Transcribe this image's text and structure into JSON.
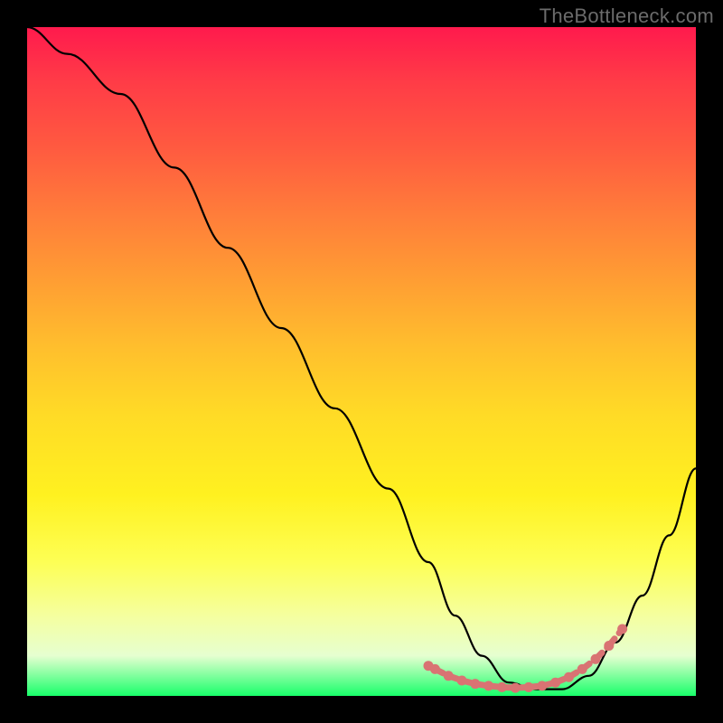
{
  "watermark": "TheBottleneck.com",
  "chart_data": {
    "type": "line",
    "title": "",
    "xlabel": "",
    "ylabel": "",
    "xlim": [
      0,
      100
    ],
    "ylim": [
      0,
      100
    ],
    "grid": false,
    "series": [
      {
        "name": "bottleneck-curve",
        "color": "#000000",
        "x": [
          0,
          6,
          14,
          22,
          30,
          38,
          46,
          54,
          60,
          64,
          68,
          72,
          76,
          80,
          84,
          88,
          92,
          96,
          100
        ],
        "values": [
          100,
          96,
          90,
          79,
          67,
          55,
          43,
          31,
          20,
          12,
          6,
          2,
          1,
          1,
          3,
          8,
          15,
          24,
          34
        ]
      }
    ],
    "markers": {
      "name": "flat-region",
      "color": "#d97373",
      "x": [
        60,
        61,
        63,
        65,
        67,
        69,
        71,
        73,
        75,
        77,
        79,
        81,
        83,
        85,
        87,
        89
      ],
      "values": [
        4.5,
        4,
        3,
        2.3,
        1.8,
        1.5,
        1.3,
        1.2,
        1.3,
        1.5,
        2.0,
        2.8,
        4.0,
        5.5,
        7.5,
        10
      ]
    },
    "gradient_stops": [
      {
        "pct": 0,
        "color": "#ff1a4d"
      },
      {
        "pct": 50,
        "color": "#ffd726"
      },
      {
        "pct": 90,
        "color": "#f7ffa0"
      },
      {
        "pct": 100,
        "color": "#18ff6a"
      }
    ]
  }
}
